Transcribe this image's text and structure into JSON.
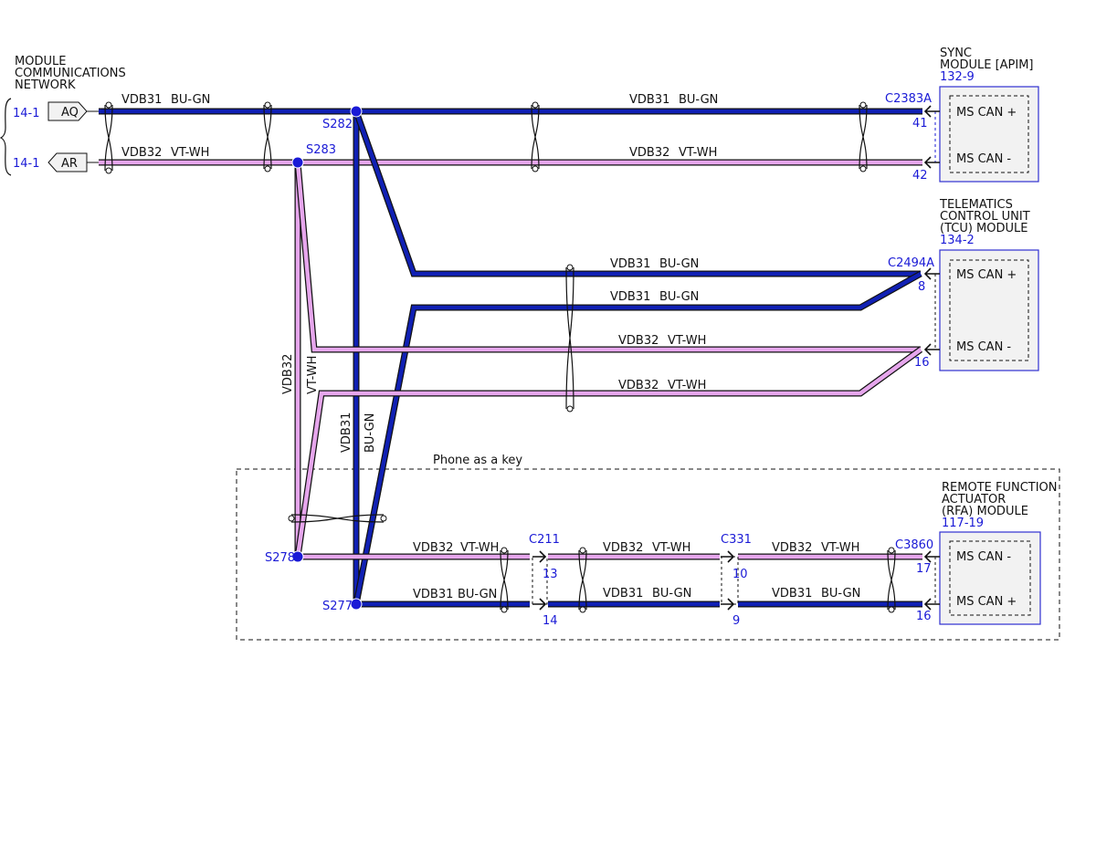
{
  "colors": {
    "blue_wire": "#1020b4",
    "pink_wire": "#e6a6ec",
    "outline": "#111111",
    "ref_text": "#1a1ad6",
    "module_border": "#3030d0",
    "module_fill": "#f2f2f2"
  },
  "network": {
    "title_lines": [
      "MODULE",
      "COMMUNICATIONS",
      "NETWORK"
    ],
    "refs": [
      {
        "page": "14-1",
        "connector": "AQ"
      },
      {
        "page": "14-1",
        "connector": "AR"
      }
    ]
  },
  "wire_labels": {
    "vdb31": "VDB31",
    "bu_gn": "BU-GN",
    "vdb32": "VDB32",
    "vt_wh": "VT-WH"
  },
  "splices": {
    "s282": "S282",
    "s283": "S283",
    "s278": "S278",
    "s277": "S277"
  },
  "modules": {
    "sync": {
      "title_lines": [
        "SYNC",
        "MODULE [APIM]"
      ],
      "page_ref": "132-9",
      "connector": "C2383A",
      "pins": [
        {
          "num": "41",
          "signal": "MS CAN +"
        },
        {
          "num": "42",
          "signal": "MS CAN -"
        }
      ]
    },
    "tcu": {
      "title_lines": [
        "TELEMATICS",
        "CONTROL UNIT",
        "(TCU) MODULE"
      ],
      "page_ref": "134-2",
      "connector": "C2494A",
      "pins": [
        {
          "num": "8",
          "signal": "MS CAN +"
        },
        {
          "num": "16",
          "signal": "MS CAN -"
        }
      ]
    },
    "rfa": {
      "title_lines": [
        "REMOTE FUNCTION",
        "ACTUATOR",
        "(RFA) MODULE"
      ],
      "page_ref": "117-19",
      "connector": "C3860",
      "pins": [
        {
          "num": "17",
          "signal": "MS CAN -"
        },
        {
          "num": "16",
          "signal": "MS CAN +"
        }
      ]
    }
  },
  "inline_connectors": {
    "c211": {
      "name": "C211",
      "pin_vt": "13",
      "pin_bu": "14"
    },
    "c331": {
      "name": "C331",
      "pin_vt": "10",
      "pin_bu": "9"
    }
  },
  "group_label": "Phone as a key"
}
